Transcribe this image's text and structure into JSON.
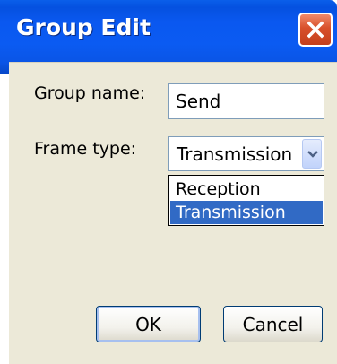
{
  "window": {
    "title": "Group Edit",
    "close_icon": "close-icon"
  },
  "form": {
    "group_name_label": "Group name:",
    "group_name_value": "Send",
    "frame_type_label": "Frame type:",
    "frame_type_value": "Transmission",
    "frame_type_options": [
      "Reception",
      "Transmission"
    ],
    "selected_option": "Transmission"
  },
  "buttons": {
    "ok_label": "OK",
    "cancel_label": "Cancel"
  },
  "colors": {
    "titlebar": "#0a58f0",
    "close_button": "#d8502b",
    "dialog_background": "#ece9d8",
    "selection": "#316ac5"
  }
}
